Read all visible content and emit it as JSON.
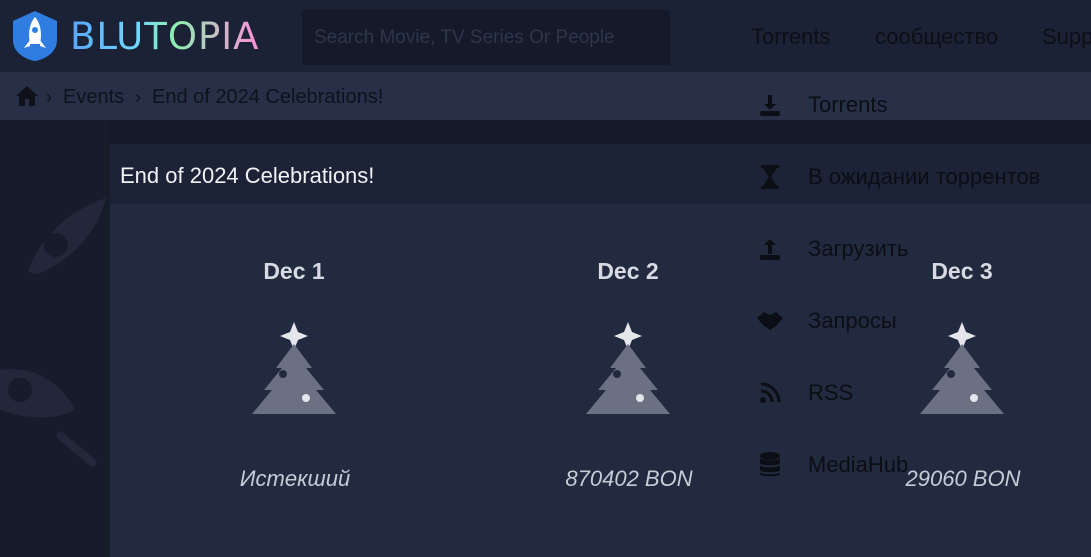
{
  "header": {
    "brand": "BLUTOPIA",
    "search_placeholder": "Search Movie, TV Series Or People",
    "nav": [
      "Torrents",
      "сообщество",
      "Supp"
    ]
  },
  "breadcrumb": [
    "Events",
    "End of 2024 Celebrations!"
  ],
  "panel": {
    "title": "End of 2024 Celebrations!",
    "days": [
      {
        "label": "Dec 1",
        "value": "Истекший"
      },
      {
        "label": "Dec 2",
        "value": "870402 BON"
      },
      {
        "label": "Dec 3",
        "value": "29060 BON"
      }
    ]
  },
  "menu": [
    {
      "icon": "download-icon",
      "label": "Torrents"
    },
    {
      "icon": "hourglass-icon",
      "label": "В ожидании торрентов"
    },
    {
      "icon": "upload-icon",
      "label": "Загрузить"
    },
    {
      "icon": "handshake-icon",
      "label": "Запросы"
    },
    {
      "icon": "rss-icon",
      "label": "RSS"
    },
    {
      "icon": "database-icon",
      "label": "MediaHub"
    }
  ],
  "colors": {
    "header_bg": "#1b2236",
    "panel_bg": "#222a40",
    "tree": "#6b7182"
  }
}
